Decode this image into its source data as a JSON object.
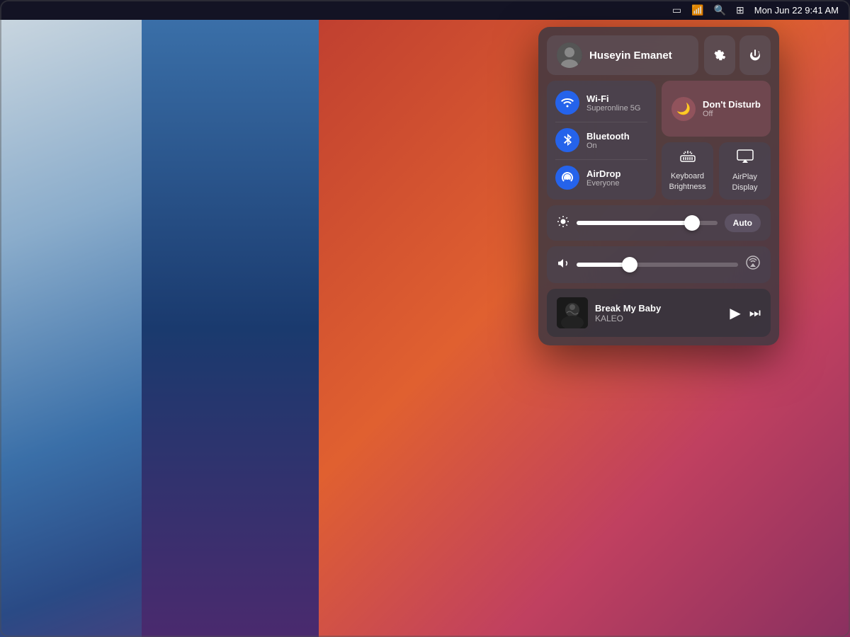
{
  "menubar": {
    "datetime": "Mon Jun 22  9:41 AM",
    "icons": [
      "battery",
      "wifi",
      "search",
      "controlcenter"
    ]
  },
  "user": {
    "name": "Huseyin Emanet",
    "avatar_emoji": "👤"
  },
  "buttons": {
    "settings_label": "⚙",
    "power_label": "⏻",
    "auto_label": "Auto"
  },
  "network": {
    "wifi": {
      "name": "Wi-Fi",
      "sub": "Superonline 5G"
    },
    "bluetooth": {
      "name": "Bluetooth",
      "sub": "On"
    },
    "airdrop": {
      "name": "AirDrop",
      "sub": "Everyone"
    }
  },
  "do_not_disturb": {
    "name": "Don't Disturb",
    "sub": "Off"
  },
  "keyboard_brightness": {
    "label1": "Keyboard",
    "label2": "Brightness"
  },
  "airplay_display": {
    "label1": "AirPlay",
    "label2": "Display"
  },
  "sliders": {
    "brightness_pct": 82,
    "volume_pct": 33
  },
  "now_playing": {
    "track": "Break My Baby",
    "artist": "KALEO"
  }
}
